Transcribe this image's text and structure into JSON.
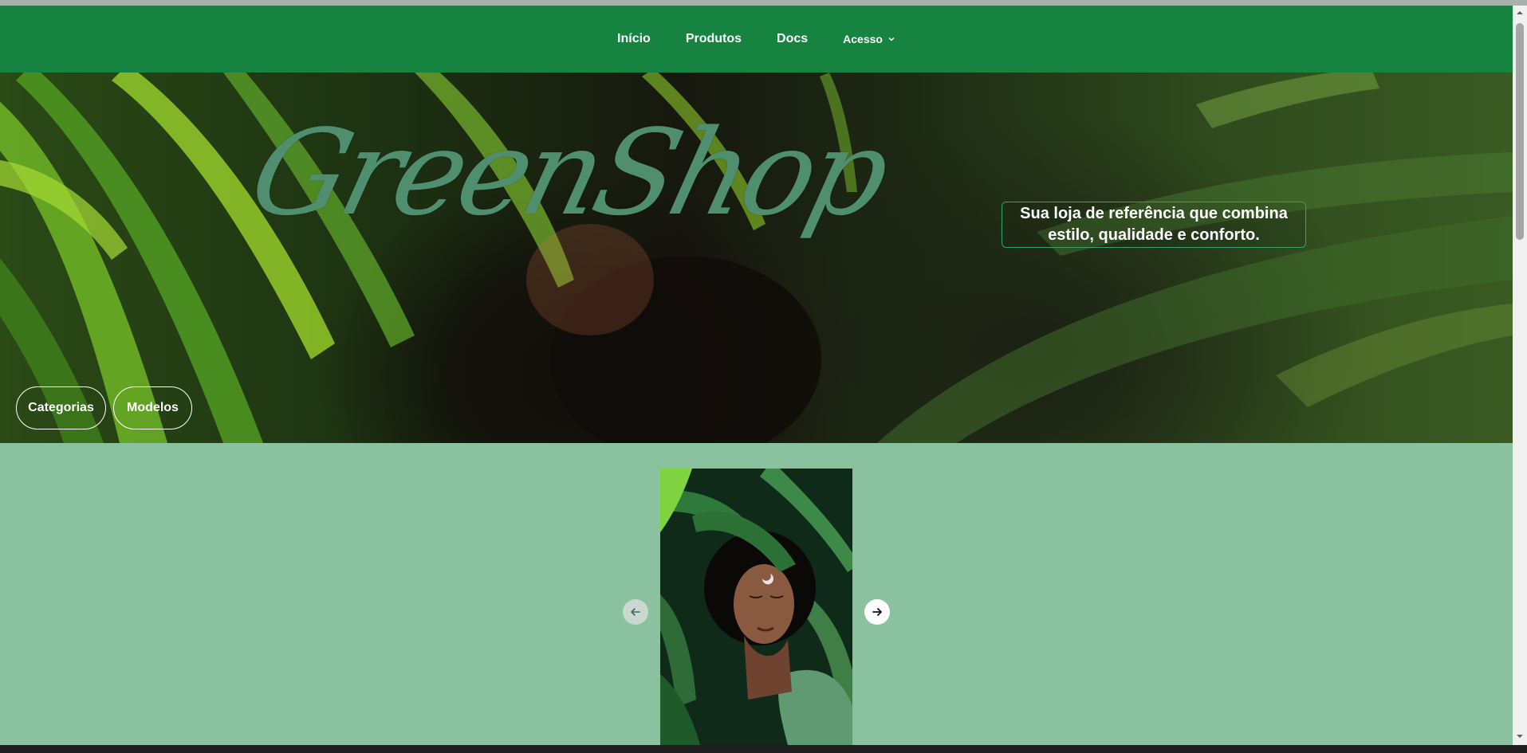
{
  "nav": {
    "items": [
      {
        "label": "Início"
      },
      {
        "label": "Produtos"
      },
      {
        "label": "Docs"
      },
      {
        "label": "Acesso",
        "icon": "chevron-down-icon"
      }
    ]
  },
  "hero": {
    "brand": "GreenShop",
    "tagline_line1": "Sua loja de referência que combina",
    "tagline_line2": "estilo, qualidade e conforto.",
    "buttons": {
      "categorias": "Categorias",
      "modelos": "Modelos"
    }
  },
  "carousel": {
    "prev_icon": "arrow-left-icon",
    "next_icon": "arrow-right-icon"
  },
  "colors": {
    "nav_bg": "#178341",
    "page_bg": "#8ac19e",
    "brand_text": "#4f8f70",
    "tagline_border": "#2ea56c"
  }
}
